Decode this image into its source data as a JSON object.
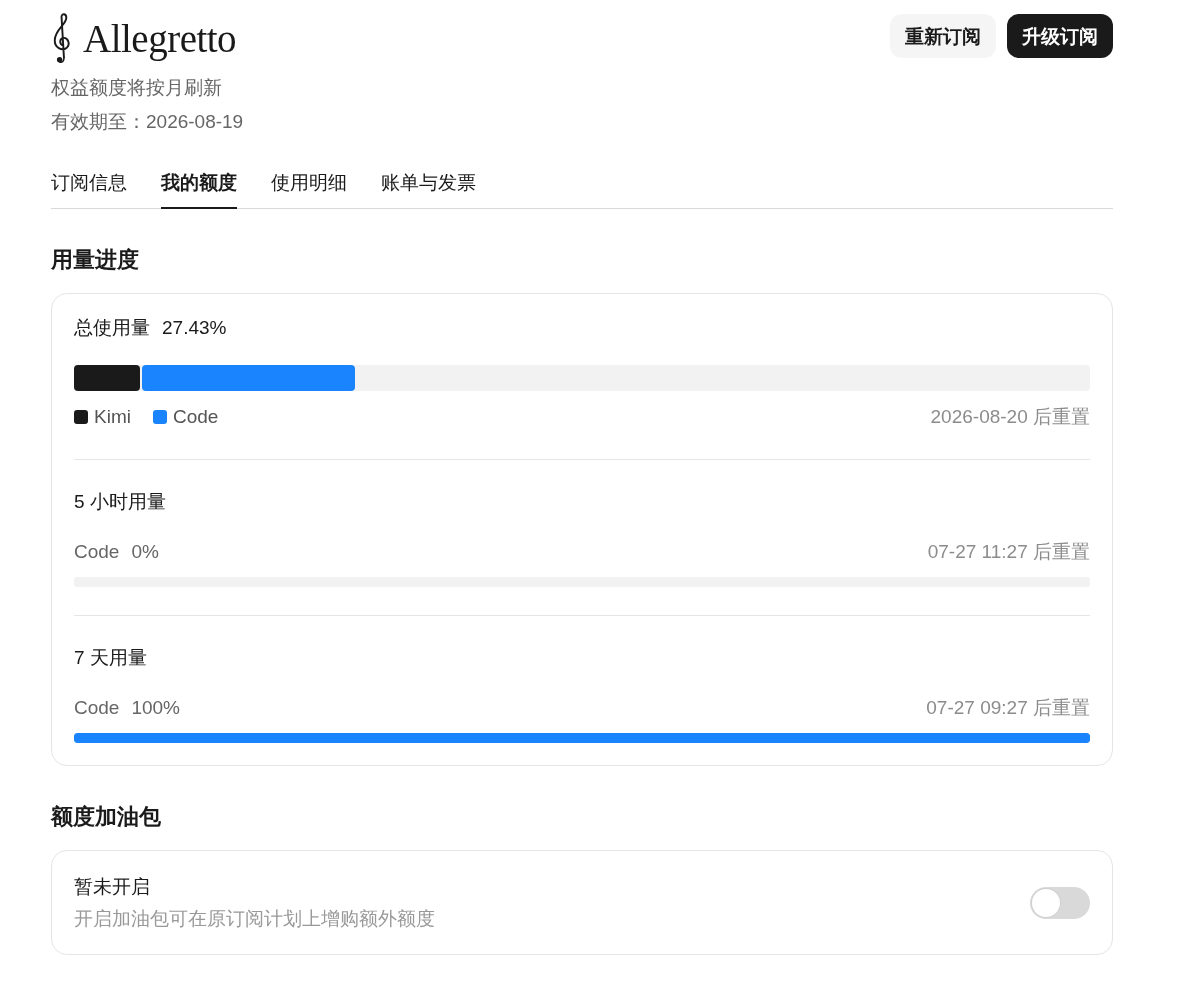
{
  "header": {
    "logo": {
      "text": "Allegretto"
    },
    "notes": [
      "权益额度将按月刷新",
      "有效期至：2026-08-19"
    ],
    "buttons": [
      {
        "label": "重新订阅",
        "kind": "secondary"
      },
      {
        "label": "升级订阅",
        "kind": "primary"
      }
    ]
  },
  "tabs": [
    {
      "label": "订阅信息",
      "selected": false
    },
    {
      "label": "我的额度",
      "selected": true
    },
    {
      "label": "使用明细",
      "selected": false
    },
    {
      "label": "账单与发票",
      "selected": false
    }
  ],
  "usage": {
    "title": "用量进度",
    "total": {
      "label": "总使用量",
      "value": "27.43%",
      "segments": [
        {
          "name": "Kimi",
          "color": "#1a1a1a",
          "level": 0.065
        },
        {
          "name": "Code",
          "color": "#1a84ff",
          "level": 0.21
        }
      ],
      "reset": "2026-08-20 后重置"
    },
    "windows": [
      {
        "title": "5 小时用量",
        "label": "Code",
        "value": "0%",
        "reset": "07-27 11:27 后重置",
        "level": 0
      },
      {
        "title": "7 天用量",
        "label": "Code",
        "value": "100%",
        "reset": "07-27 09:27 后重置",
        "level": 1
      }
    ]
  },
  "addon": {
    "title": "额度加油包",
    "status": "暂未开启",
    "description": "开启加油包可在原订阅计划上增购额外额度",
    "on": false
  }
}
